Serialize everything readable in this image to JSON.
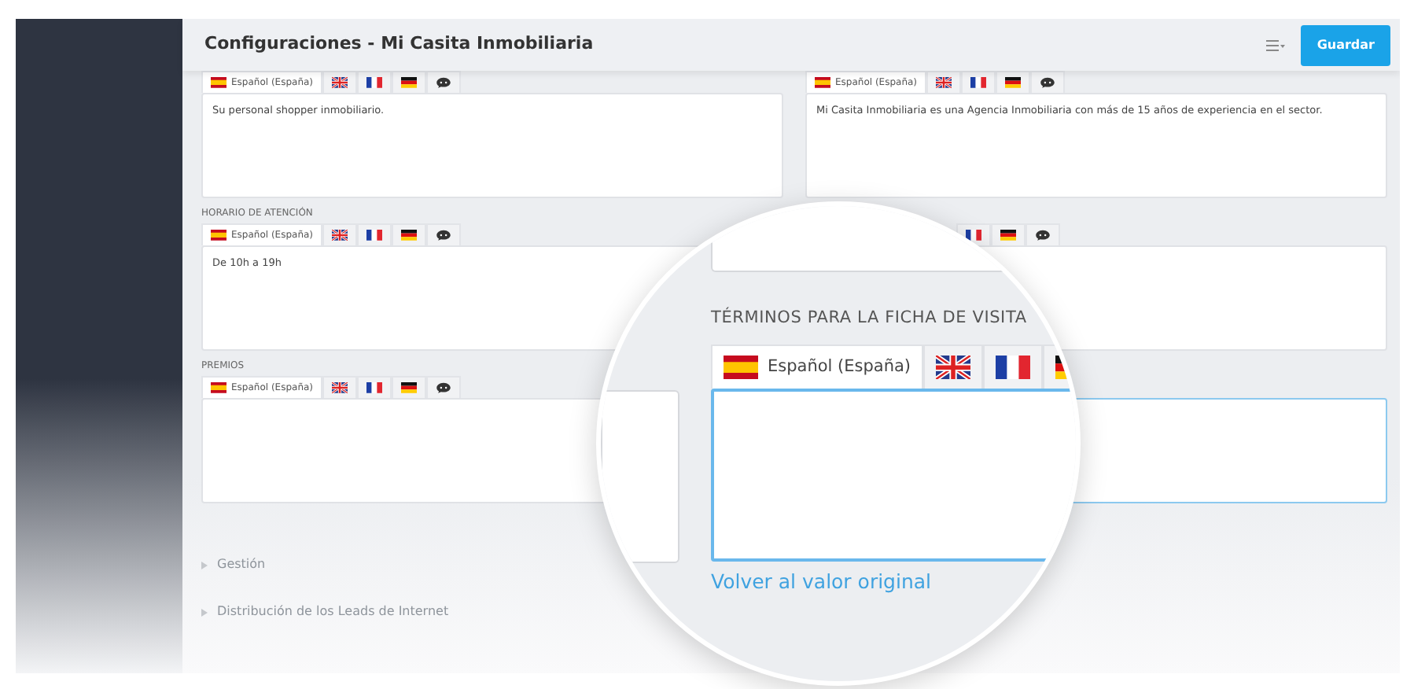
{
  "window": {
    "title": "Configuraciones - Mi Casita Inmobiliaria"
  },
  "toolbar": {
    "save_button": "Guardar"
  },
  "fields": [
    {
      "tabs": [
        {
          "kind": "es",
          "label": "Español (España)",
          "selected": true
        },
        {
          "kind": "gb",
          "selected": false
        },
        {
          "kind": "fr",
          "selected": false
        },
        {
          "kind": "de",
          "selected": false
        },
        {
          "kind": "comments",
          "selected": false
        }
      ],
      "value": "Su personal shopper inmobiliario.",
      "focused": false
    },
    {
      "tabs": [
        {
          "kind": "es",
          "label": "Español (España)",
          "selected": true
        },
        {
          "kind": "gb",
          "selected": false
        },
        {
          "kind": "fr",
          "selected": false
        },
        {
          "kind": "de",
          "selected": false
        },
        {
          "kind": "comments",
          "selected": false
        }
      ],
      "value": "Mi Casita Inmobiliaria es una Agencia Inmobiliaria con más de 15 años de experiencia en el sector.",
      "focused": false
    },
    {
      "label": "HORARIO DE ATENCIÓN",
      "tabs": [
        {
          "kind": "es",
          "label": "Español (España)",
          "selected": true
        },
        {
          "kind": "gb",
          "selected": false
        },
        {
          "kind": "fr",
          "selected": false
        },
        {
          "kind": "de",
          "selected": false
        },
        {
          "kind": "comments",
          "selected": false
        }
      ],
      "value": "De 10h a 19h",
      "focused": false
    },
    {
      "tabs": [
        {
          "kind": "fr",
          "selected": false
        },
        {
          "kind": "de",
          "selected": false
        },
        {
          "kind": "comments",
          "selected": false
        }
      ],
      "focused": false
    },
    {
      "label": "PREMIOS",
      "tabs": [
        {
          "kind": "es",
          "label": "Español (España)",
          "selected": true
        },
        {
          "kind": "gb",
          "selected": false
        },
        {
          "kind": "fr",
          "selected": false
        },
        {
          "kind": "de",
          "selected": false
        },
        {
          "kind": "comments",
          "selected": false
        }
      ],
      "focused": false
    },
    {
      "focused": true
    }
  ],
  "sections": [
    {
      "label": "Gestión",
      "expanded": false
    },
    {
      "label": "Distribución de los Leads de Internet",
      "expanded": false
    }
  ],
  "magnifier": {
    "label": "TÉRMINOS PARA LA FICHA DE VISITA",
    "tabs": [
      {
        "kind": "es",
        "label": "Español (España)",
        "selected": true
      },
      {
        "kind": "gb",
        "selected": false
      },
      {
        "kind": "fr",
        "selected": false
      },
      {
        "kind": "de",
        "selected": false
      }
    ],
    "focused": true,
    "link": "Volver al valor original"
  }
}
